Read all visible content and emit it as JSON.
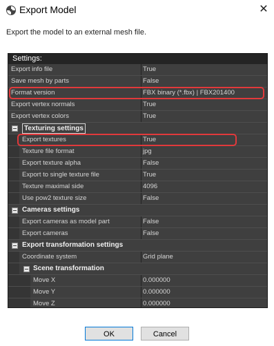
{
  "window": {
    "title": "Export Model",
    "close_glyph": "✕"
  },
  "description": "Export the model to an external mesh file.",
  "panel": {
    "header": "Settings:"
  },
  "rows": [
    {
      "kind": "prop",
      "indent": 0,
      "name": "Export info file",
      "value": "True"
    },
    {
      "kind": "prop",
      "indent": 0,
      "name": "Save mesh by parts",
      "value": "False"
    },
    {
      "kind": "prop",
      "indent": 0,
      "name": "Format version",
      "value": "FBX binary (*.fbx) | FBX201400",
      "highlight": true
    },
    {
      "kind": "prop",
      "indent": 0,
      "name": "Export vertex normals",
      "value": "True"
    },
    {
      "kind": "prop",
      "indent": 0,
      "name": "Export vertex colors",
      "value": "True"
    },
    {
      "kind": "section",
      "level": 0,
      "label": "Texturing settings",
      "boxed": true
    },
    {
      "kind": "prop",
      "indent": 1,
      "name": "Export textures",
      "value": "True",
      "highlight": true
    },
    {
      "kind": "prop",
      "indent": 1,
      "name": "Texture file format",
      "value": "jpg"
    },
    {
      "kind": "prop",
      "indent": 1,
      "name": "Export texture alpha",
      "value": "False"
    },
    {
      "kind": "prop",
      "indent": 1,
      "name": "Export to single texture file",
      "value": "True"
    },
    {
      "kind": "prop",
      "indent": 1,
      "name": "Texture maximal side",
      "value": "4096"
    },
    {
      "kind": "prop",
      "indent": 1,
      "name": "Use pow2 texture size",
      "value": "False"
    },
    {
      "kind": "section",
      "level": 0,
      "label": "Cameras settings"
    },
    {
      "kind": "prop",
      "indent": 1,
      "name": "Export cameras as model part",
      "value": "False"
    },
    {
      "kind": "prop",
      "indent": 1,
      "name": "Export cameras",
      "value": "False"
    },
    {
      "kind": "section",
      "level": 0,
      "label": "Export transformation settings"
    },
    {
      "kind": "prop",
      "indent": 1,
      "name": "Coordinate system",
      "value": "Grid plane"
    },
    {
      "kind": "section",
      "level": 1,
      "label": "Scene transformation"
    },
    {
      "kind": "prop",
      "indent": 2,
      "name": "Move X",
      "value": "0.000000"
    },
    {
      "kind": "prop",
      "indent": 2,
      "name": "Move Y",
      "value": "0.000000"
    },
    {
      "kind": "prop",
      "indent": 2,
      "name": "Move Z",
      "value": "0.000000"
    },
    {
      "kind": "prop",
      "indent": 2,
      "name": "Scale X",
      "value": "1.000000"
    }
  ],
  "buttons": {
    "ok": "OK",
    "cancel": "Cancel"
  },
  "colors": {
    "panel_bg": "#3f3f3f",
    "highlight": "#e2393b",
    "ok_border": "#0078d7"
  },
  "icons": {
    "app": "metashape-app-icon",
    "close": "close-icon"
  }
}
